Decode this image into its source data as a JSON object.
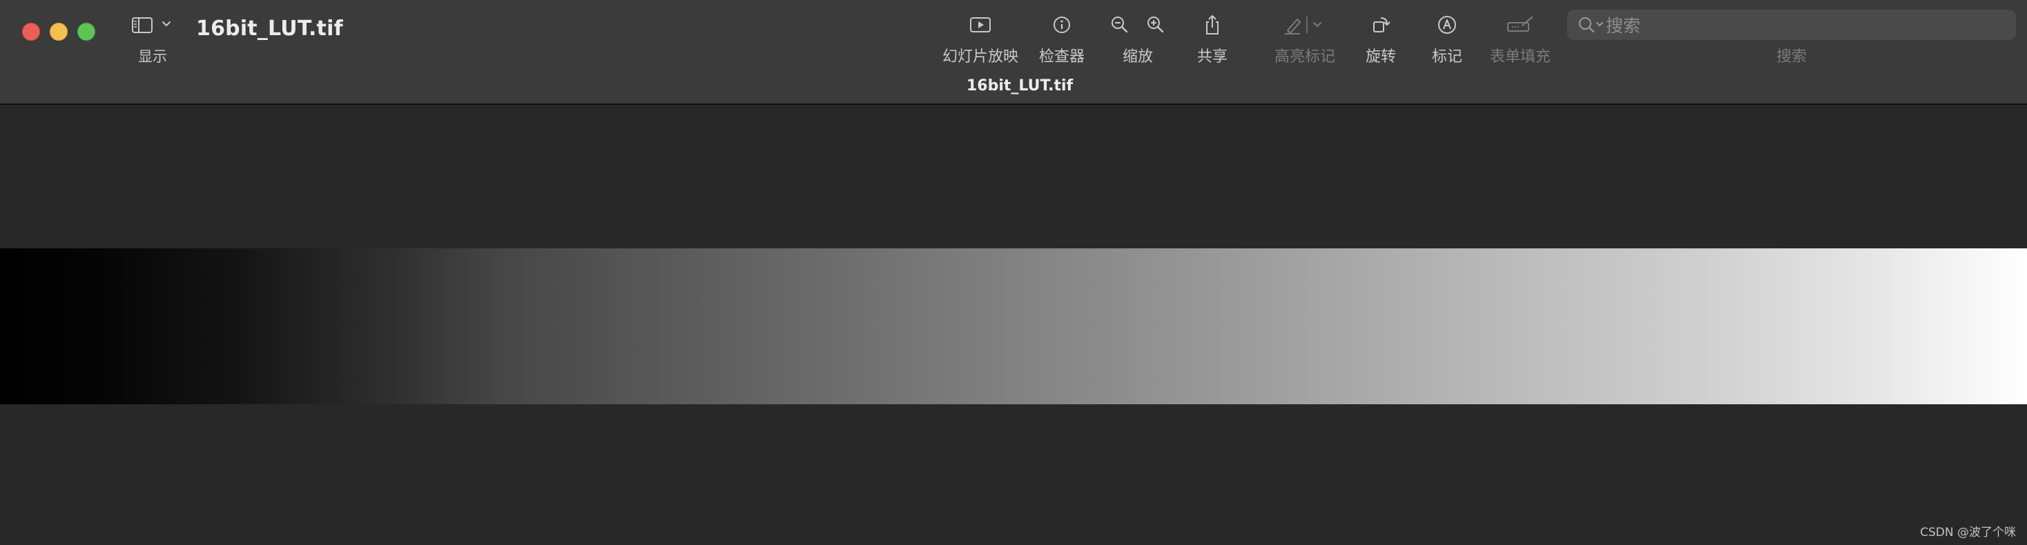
{
  "window": {
    "title": "16bit_LUT.tif",
    "document_subtitle": "16bit_LUT.tif"
  },
  "toolbar": {
    "sidebar_toggle_label": "显示",
    "slideshow_label": "幻灯片放映",
    "inspector_label": "检查器",
    "zoom_label": "缩放",
    "share_label": "共享",
    "highlight_label": "高亮标记",
    "rotate_label": "旋转",
    "markup_label": "标记",
    "form_fill_label": "表单填充"
  },
  "search": {
    "placeholder": "搜索",
    "caption": "搜索"
  },
  "watermark": "CSDN @波了个咪",
  "colors": {
    "toolbar_bg": "#3b3b3b",
    "canvas_bg": "#282828",
    "close": "#ec5f57",
    "minimize": "#f5be4f",
    "zoom": "#5fc454"
  },
  "icons": {
    "slideshow": "play-rectangle-icon",
    "inspector": "info-circle-icon",
    "zoom_out": "magnifier-minus-icon",
    "zoom_in": "magnifier-plus-icon",
    "share": "share-up-icon",
    "highlight": "highlighter-pen-icon",
    "rotate": "rotate-square-icon",
    "markup": "pen-circle-icon",
    "form_fill": "form-pen-icon"
  }
}
